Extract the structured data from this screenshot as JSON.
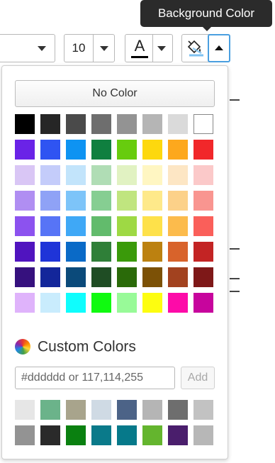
{
  "tooltip": {
    "text": "Background Color"
  },
  "toolbar": {
    "font_size": "10",
    "text_color_glyph": "A",
    "icons": {
      "font_caret": "chevron-down-icon",
      "size_caret": "chevron-down-icon",
      "text_color": "text-color-icon",
      "background": "paint-bucket-icon",
      "toggle": "chevron-up-icon"
    }
  },
  "picker": {
    "no_color_label": "No Color",
    "palette": [
      [
        "#000000",
        "#262626",
        "#4a4a4a",
        "#6e6e6e",
        "#939393",
        "#b5b5b5",
        "#dadada",
        "#ffffff"
      ],
      [
        "#6a23e7",
        "#2f54f2",
        "#0e93f2",
        "#0f7f3f",
        "#67cc0e",
        "#fdd80e",
        "#fda81d",
        "#f1272a"
      ],
      [
        "#d9c6f5",
        "#c4ccfa",
        "#c2e4fb",
        "#b0ddb5",
        "#e1f2c2",
        "#fff6c2",
        "#fde6c4",
        "#fbc9c9"
      ],
      [
        "#b08ef2",
        "#8fa2f6",
        "#7dc4f9",
        "#86ce92",
        "#c0e57f",
        "#fee98a",
        "#fcd189",
        "#f99590"
      ],
      [
        "#8c52ef",
        "#5774f6",
        "#3fa8f6",
        "#62bb6c",
        "#9ed944",
        "#fee14a",
        "#fcbb4c",
        "#fa5f5a"
      ],
      [
        "#5014bf",
        "#1f34d8",
        "#0a6ac7",
        "#2f7f38",
        "#3a9a0a",
        "#bc8110",
        "#d8632b",
        "#c32424"
      ],
      [
        "#36117e",
        "#13269a",
        "#0b4a7a",
        "#1f4d24",
        "#2a6a09",
        "#7c5106",
        "#a2421f",
        "#7e1818"
      ],
      [
        "#dfb3fb",
        "#c9ecfd",
        "#0ffdfd",
        "#10fa10",
        "#98fa98",
        "#fdfd10",
        "#fd0ba8",
        "#c7059d"
      ]
    ],
    "custom_title": "Custom Colors",
    "custom_icon": "color-wheel-icon",
    "hex_placeholder": "#dddddd or 117,114,255",
    "add_label": "Add",
    "custom_colors": [
      [
        "#e6e6e6",
        "#6bb38a",
        "#a8a48c",
        "#cfdae4",
        "#4c6387",
        "#b5b5b5",
        "#6e6e6e",
        "#c2c2c2"
      ],
      [
        "#939393",
        "#2a2a2a",
        "#0a8010",
        "#0a7a8a",
        "#06798a",
        "#64b52e",
        "#4a1e6c",
        "#b7b7b7"
      ]
    ]
  }
}
